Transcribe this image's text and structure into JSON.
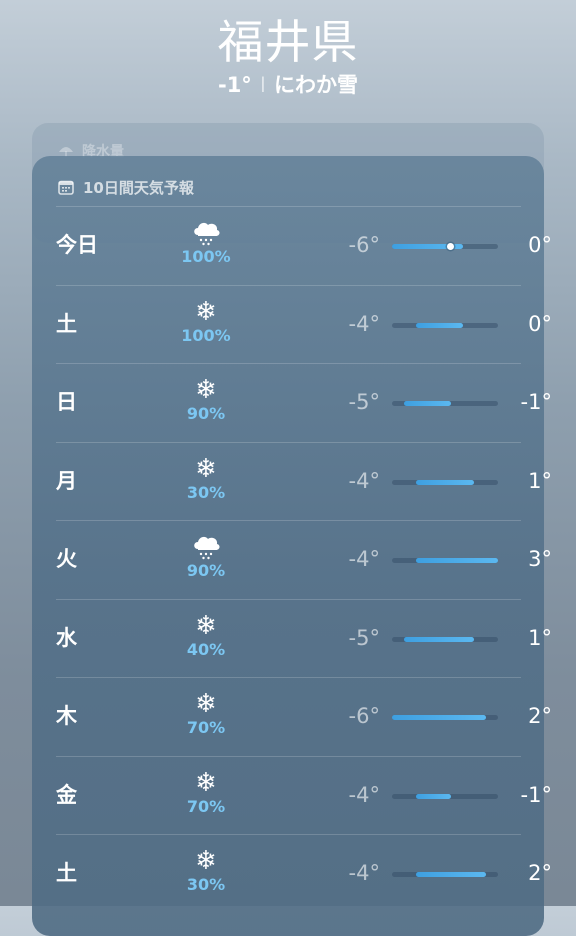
{
  "header": {
    "city": "福井県",
    "temperature": "-1°",
    "separator": "I",
    "condition": "にわか雪"
  },
  "back_card": {
    "title": "降水量",
    "icon": "umbrella-icon"
  },
  "forecast": {
    "title": "10日間天気予報",
    "icon": "calendar-icon",
    "range_min": -6,
    "range_max": 3,
    "current_temp": -1,
    "days": [
      {
        "day": "今日",
        "icon": "cloud-snow-icon",
        "precip": "100%",
        "low": "-6°",
        "high": "0°",
        "low_val": -6,
        "high_val": 0,
        "show_current": true
      },
      {
        "day": "土",
        "icon": "snowflake-icon",
        "precip": "100%",
        "low": "-4°",
        "high": "0°",
        "low_val": -4,
        "high_val": 0,
        "show_current": false
      },
      {
        "day": "日",
        "icon": "snowflake-icon",
        "precip": "90%",
        "low": "-5°",
        "high": "-1°",
        "low_val": -5,
        "high_val": -1,
        "show_current": false
      },
      {
        "day": "月",
        "icon": "snowflake-icon",
        "precip": "30%",
        "low": "-4°",
        "high": "1°",
        "low_val": -4,
        "high_val": 1,
        "show_current": false
      },
      {
        "day": "火",
        "icon": "cloud-snow-icon",
        "precip": "90%",
        "low": "-4°",
        "high": "3°",
        "low_val": -4,
        "high_val": 3,
        "show_current": false
      },
      {
        "day": "水",
        "icon": "snowflake-icon",
        "precip": "40%",
        "low": "-5°",
        "high": "1°",
        "low_val": -5,
        "high_val": 1,
        "show_current": false
      },
      {
        "day": "木",
        "icon": "snowflake-icon",
        "precip": "70%",
        "low": "-6°",
        "high": "2°",
        "low_val": -6,
        "high_val": 2,
        "show_current": false
      },
      {
        "day": "金",
        "icon": "snowflake-icon",
        "precip": "70%",
        "low": "-4°",
        "high": "-1°",
        "low_val": -4,
        "high_val": -1,
        "show_current": false
      },
      {
        "day": "土",
        "icon": "snowflake-icon",
        "precip": "30%",
        "low": "-4°",
        "high": "2°",
        "low_val": -4,
        "high_val": 2,
        "show_current": false
      }
    ]
  },
  "colors": {
    "precip_text": "#7cc7f2",
    "bar_fill": "#4aaeea",
    "bar_track": "#3a5670"
  }
}
